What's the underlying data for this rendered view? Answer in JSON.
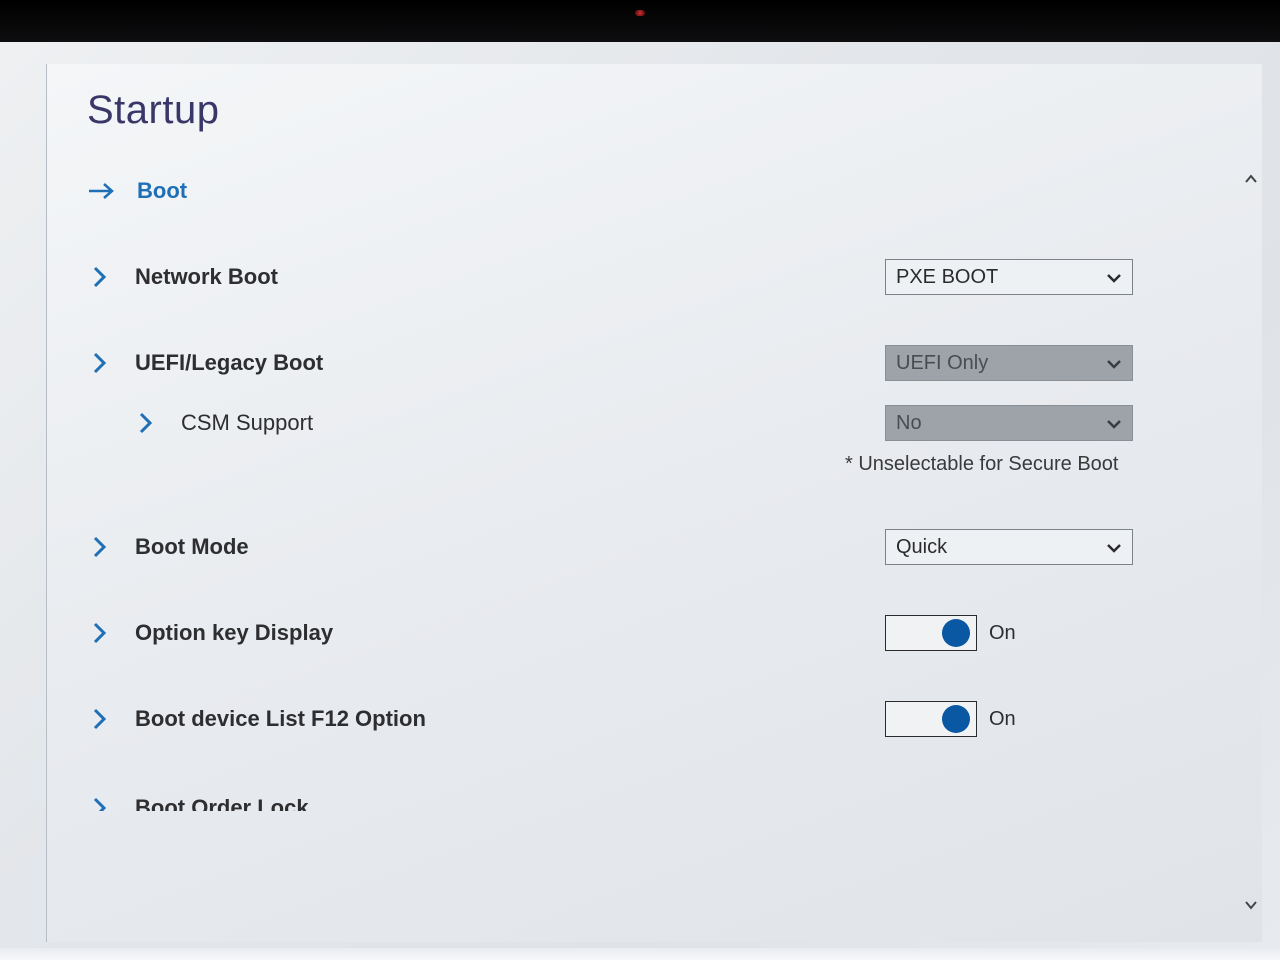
{
  "page": {
    "title": "Startup"
  },
  "rows": {
    "boot_link": "Boot",
    "network_boot": {
      "label": "Network Boot",
      "value": "PXE BOOT"
    },
    "uefi_legacy": {
      "label": "UEFI/Legacy Boot",
      "value": "UEFI Only"
    },
    "csm": {
      "label": "CSM Support",
      "value": "No"
    },
    "note": "* Unselectable for Secure Boot",
    "boot_mode": {
      "label": "Boot Mode",
      "value": "Quick"
    },
    "option_key": {
      "label": "Option key Display",
      "state": "On"
    },
    "f12": {
      "label": "Boot device List F12 Option",
      "state": "On"
    },
    "boot_order_lock": {
      "label": "Boot Order Lock"
    }
  }
}
